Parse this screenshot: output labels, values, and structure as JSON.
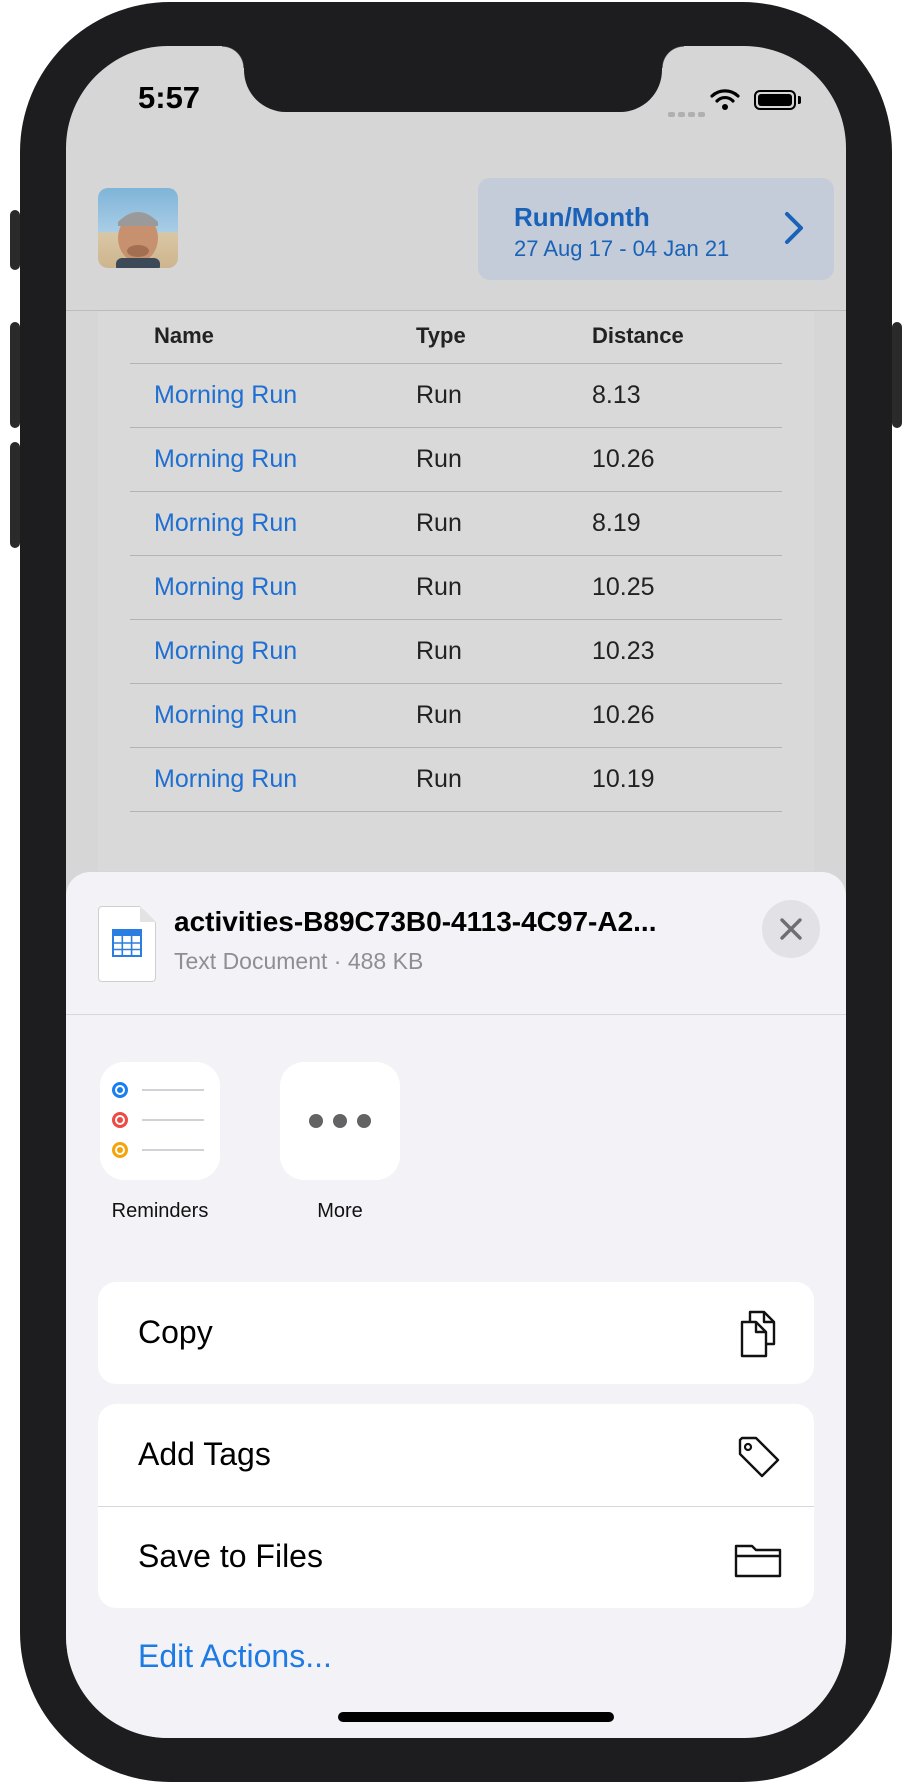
{
  "status_bar": {
    "time": "5:57"
  },
  "header": {
    "nav_card": {
      "title": "Run/Month",
      "subtitle": "27 Aug 17 - 04 Jan 21"
    }
  },
  "table": {
    "columns": [
      "Name",
      "Type",
      "Distance"
    ],
    "rows": [
      {
        "name": "Morning Run",
        "type": "Run",
        "distance": "8.13"
      },
      {
        "name": "Morning Run",
        "type": "Run",
        "distance": "10.26"
      },
      {
        "name": "Morning Run",
        "type": "Run",
        "distance": "8.19"
      },
      {
        "name": "Morning Run",
        "type": "Run",
        "distance": "10.25"
      },
      {
        "name": "Morning Run",
        "type": "Run",
        "distance": "10.23"
      },
      {
        "name": "Morning Run",
        "type": "Run",
        "distance": "10.26"
      },
      {
        "name": "Morning Run",
        "type": "Run",
        "distance": "10.19"
      }
    ]
  },
  "share_sheet": {
    "file_name": "activities-B89C73B0-4113-4C97-A2...",
    "file_meta": "Text Document · 488 KB",
    "apps": [
      {
        "label": "Reminders",
        "icon": "reminders-icon"
      },
      {
        "label": "More",
        "icon": "more-icon"
      }
    ],
    "actions": {
      "copy": "Copy",
      "add_tags": "Add Tags",
      "save_to_files": "Save to Files"
    },
    "edit_actions": "Edit Actions..."
  },
  "colors": {
    "link": "#1e6fd1",
    "nav_card_bg": "#c3ccd8",
    "sheet_bg": "#f2f2f7",
    "reminder_dots": [
      "#1a7ef0",
      "#ee4a42",
      "#f5a30a"
    ]
  }
}
